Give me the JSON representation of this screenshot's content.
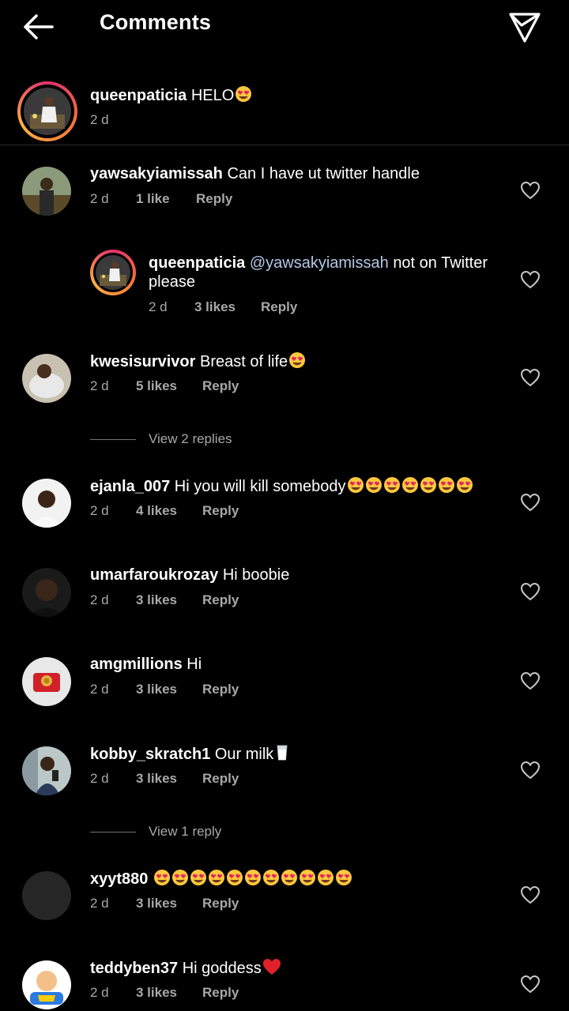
{
  "header": {
    "title": "Comments"
  },
  "caption": {
    "username": "queenpaticia",
    "text": "HELO",
    "emoji": "😍",
    "time": "2 d"
  },
  "comments": [
    {
      "username": "yawsakyiamissah",
      "text": "Can I have ut twitter handle",
      "time": "2 d",
      "likes": "1 like",
      "reply": "Reply"
    },
    {
      "username": "queenpaticia",
      "mention": "@yawsakyiamissah",
      "text_line1": "not on Twitter",
      "text_line2": "please",
      "time": "2 d",
      "likes": "3 likes",
      "reply": "Reply"
    },
    {
      "username": "kwesisurvivor",
      "text": "Breast of life",
      "time": "2 d",
      "likes": "5 likes",
      "reply": "Reply"
    },
    {
      "username": "ejanla_007",
      "text": "Hi you will kill somebody",
      "time": "2 d",
      "likes": "4 likes",
      "reply": "Reply"
    },
    {
      "username": "umarfaroukrozay",
      "text": "Hi boobie",
      "time": "2 d",
      "likes": "3 likes",
      "reply": "Reply"
    },
    {
      "username": "amgmillions",
      "text": "Hi",
      "time": "2 d",
      "likes": "3 likes",
      "reply": "Reply"
    },
    {
      "username": "kobby_skratch1",
      "text": "Our milk",
      "time": "2 d",
      "likes": "3 likes",
      "reply": "Reply"
    },
    {
      "username": "xyyt880",
      "text": "",
      "time": "2 d",
      "likes": "3 likes",
      "reply": "Reply"
    },
    {
      "username": "teddyben37",
      "text": "Hi goddess",
      "time": "2 d",
      "likes": "3 likes",
      "reply": "Reply"
    }
  ],
  "view_replies": [
    {
      "label": "View 2 replies"
    },
    {
      "label": "View 1 reply"
    }
  ],
  "icons": {
    "back": "arrow-left-icon",
    "send": "paper-plane-icon",
    "like": "heart-outline-icon"
  },
  "colors": {
    "background": "#000000",
    "text": "#ffffff",
    "meta": "#a8a8a8",
    "mention": "#b3c7e6"
  }
}
